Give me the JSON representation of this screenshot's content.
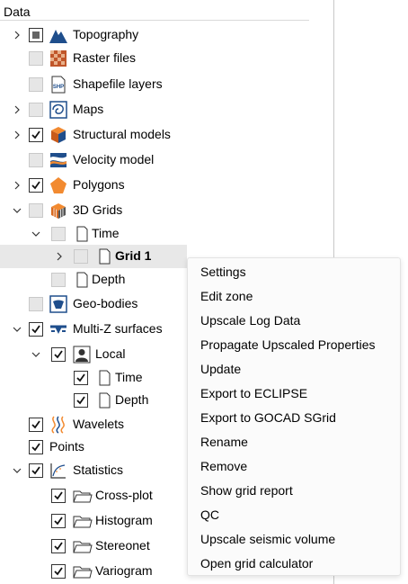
{
  "panel": {
    "header": "Data"
  },
  "tree": [
    {
      "label": "Topography",
      "icon": "topography-icon",
      "check": "partial",
      "expander": "collapsed"
    },
    {
      "label": "Raster files",
      "icon": "raster-icon",
      "check": "disabled",
      "expander": "none"
    },
    {
      "label": "Shapefile layers",
      "icon": "shapefile-icon",
      "check": "disabled",
      "expander": "none"
    },
    {
      "label": "Maps",
      "icon": "map-icon",
      "check": "disabled",
      "expander": "collapsed"
    },
    {
      "label": "Structural models",
      "icon": "structural-model-icon",
      "check": "checked",
      "expander": "collapsed"
    },
    {
      "label": "Velocity model",
      "icon": "velocity-model-icon",
      "check": "disabled",
      "expander": "none"
    },
    {
      "label": "Polygons",
      "icon": "polygon-icon",
      "check": "checked",
      "expander": "collapsed"
    },
    {
      "label": "3D Grids",
      "icon": "grid3d-icon",
      "check": "disabled",
      "expander": "expanded"
    },
    {
      "label": "Time",
      "icon": "page-icon",
      "check": "disabled",
      "expander": "expanded"
    },
    {
      "label": "Grid 1",
      "icon": "page-icon",
      "check": "disabled",
      "expander": "collapsed",
      "selected": true
    },
    {
      "label": "Depth",
      "icon": "page-icon",
      "check": "disabled",
      "expander": "none"
    },
    {
      "label": "Geo-bodies",
      "icon": "geobody-icon",
      "check": "disabled",
      "expander": "none"
    },
    {
      "label": "Multi-Z surfaces",
      "icon": "multiz-surface-icon",
      "check": "checked",
      "expander": "expanded"
    },
    {
      "label": "Local",
      "icon": "user-icon",
      "check": "checked",
      "expander": "expanded"
    },
    {
      "label": "Time",
      "icon": "page-icon",
      "check": "checked",
      "expander": "none"
    },
    {
      "label": "Depth",
      "icon": "page-icon",
      "check": "checked",
      "expander": "none"
    },
    {
      "label": "Wavelets",
      "icon": "wavelet-icon",
      "check": "checked",
      "expander": "none"
    },
    {
      "label": "Points",
      "icon": "",
      "check": "checked",
      "expander": "none"
    },
    {
      "label": "Statistics",
      "icon": "statistics-icon",
      "check": "checked",
      "expander": "expanded"
    },
    {
      "label": "Cross-plot",
      "icon": "folder-icon",
      "check": "checked",
      "expander": "none"
    },
    {
      "label": "Histogram",
      "icon": "folder-icon",
      "check": "checked",
      "expander": "none"
    },
    {
      "label": "Stereonet",
      "icon": "folder-icon",
      "check": "checked",
      "expander": "none"
    },
    {
      "label": "Variogram",
      "icon": "folder-icon",
      "check": "checked",
      "expander": "none"
    }
  ],
  "context_menu": {
    "items": [
      "Settings",
      "Edit zone",
      "Upscale Log Data",
      "Propagate Upscaled Properties",
      "Update",
      "Export to ECLIPSE",
      "Export to GOCAD SGrid",
      "Rename",
      "Remove",
      "Show grid report",
      "QC",
      "Upscale seismic volume",
      "Open grid calculator"
    ]
  },
  "colors": {
    "accent": "#1f4e8c",
    "selection": "#e8e8e8"
  }
}
